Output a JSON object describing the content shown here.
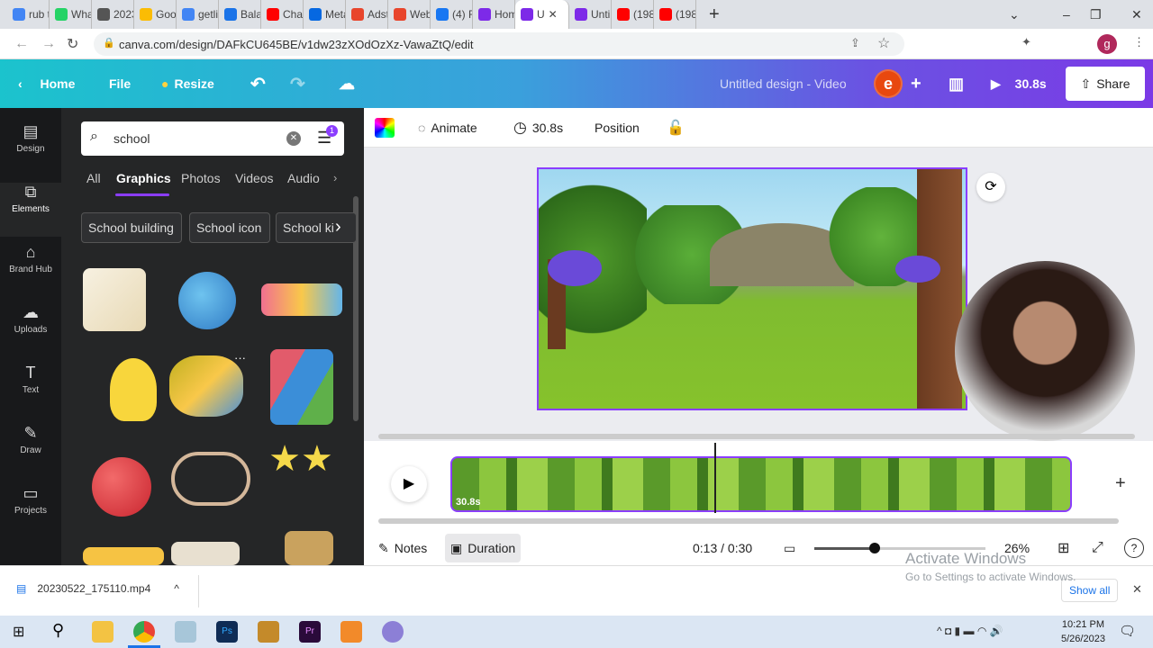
{
  "browser": {
    "tabs": [
      {
        "label": "rub t",
        "color": "#4285f4"
      },
      {
        "label": "What",
        "color": "#25d366"
      },
      {
        "label": "2023",
        "color": "#555555"
      },
      {
        "label": "Goog",
        "color": "#fbbc04"
      },
      {
        "label": "getli",
        "color": "#4285f4"
      },
      {
        "label": "Balar",
        "color": "#1a73e8"
      },
      {
        "label": "Chan",
        "color": "#ff0000"
      },
      {
        "label": "Meta",
        "color": "#0668e1"
      },
      {
        "label": "Adsto",
        "color": "#e8452c"
      },
      {
        "label": "Webs",
        "color": "#e8452c"
      },
      {
        "label": "(4) Fa",
        "color": "#1877f2"
      },
      {
        "label": "Hom",
        "color": "#7d2ae8"
      },
      {
        "label": "U",
        "color": "#7d2ae8",
        "active": true
      },
      {
        "label": "Unti",
        "color": "#7d2ae8"
      },
      {
        "label": "(198",
        "color": "#ff0000"
      },
      {
        "label": "(198",
        "color": "#ff0000"
      }
    ],
    "url": "canva.com/design/DAFkCU645BE/v1dw23zXOdOzXz-VawaZtQ/edit",
    "profile_initial": "g"
  },
  "header": {
    "home": "Home",
    "file": "File",
    "resize": "Resize",
    "title": "Untitled design - Video",
    "avatar": "e",
    "play_duration": "30.8s",
    "share": "Share"
  },
  "rail": [
    {
      "label": "Design",
      "icon": "layout-icon"
    },
    {
      "label": "Elements",
      "icon": "shapes-icon",
      "active": true
    },
    {
      "label": "Brand Hub",
      "icon": "brand-icon"
    },
    {
      "label": "Uploads",
      "icon": "cloud-upload-icon"
    },
    {
      "label": "Text",
      "icon": "text-icon"
    },
    {
      "label": "Draw",
      "icon": "pen-icon"
    },
    {
      "label": "Projects",
      "icon": "folder-icon"
    }
  ],
  "panel": {
    "search_value": "school",
    "filter_badge": "1",
    "filter_tabs": [
      "All",
      "Graphics",
      "Photos",
      "Videos",
      "Audio"
    ],
    "active_tab": "Graphics",
    "chips": [
      "School building",
      "School icon",
      "School ki"
    ]
  },
  "toolbar": {
    "animate": "Animate",
    "duration": "30.8s",
    "position": "Position"
  },
  "timeline": {
    "clip_duration": "30.8s"
  },
  "bottom": {
    "notes": "Notes",
    "duration": "Duration",
    "time": "0:13 / 0:30",
    "zoom": "26%",
    "zoom_fraction": 0.35
  },
  "watermark": {
    "line1": "Activate Windows",
    "line2": "Go to Settings to activate Windows."
  },
  "download": {
    "file": "20230522_175110.mp4",
    "show_all": "Show all"
  },
  "taskbar": {
    "time": "10:21 PM",
    "date": "5/26/2023"
  }
}
